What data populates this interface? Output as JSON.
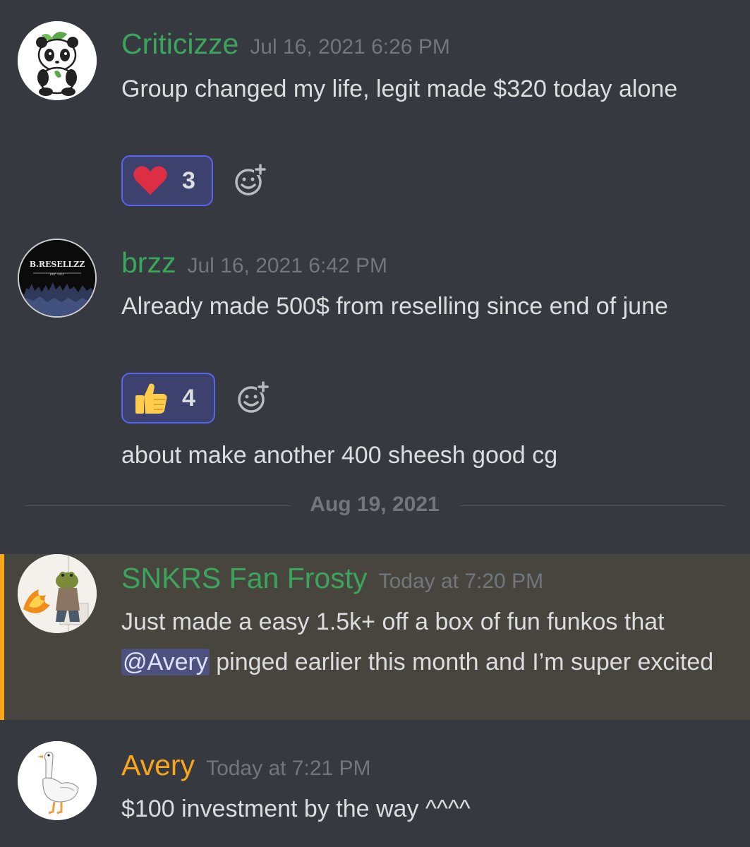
{
  "messages": [
    {
      "author": "Criticizze",
      "author_color": "#3ba55c",
      "timestamp": "Jul 16, 2021 6:26 PM",
      "text": "Group changed my life, legit made $320 today alone",
      "reaction": {
        "emoji": "heart-icon",
        "count": "3"
      }
    },
    {
      "author": "brzz",
      "author_color": "#3ba55c",
      "avatar_text": "B.RESELLZZ",
      "avatar_subtext": "EST. 2021",
      "timestamp": "Jul 16, 2021 6:42 PM",
      "text": "Already made 500$ from reselling since end of june",
      "reaction": {
        "emoji": "thumbs-up-icon",
        "count": "4"
      },
      "followup": "about make another 400 sheesh good cg"
    },
    {
      "author": "SNKRS Fan Frosty",
      "author_color": "#3ba55c",
      "timestamp": "Today at 7:20 PM",
      "text_before": "Just made a easy 1.5k+ off a box of fun funkos that ",
      "mention": "@Avery",
      "text_after": " pinged earlier this month and I’m super excited",
      "highlighted": true
    },
    {
      "author": "Avery",
      "author_color": "#faa61a",
      "timestamp": "Today at 7:21 PM",
      "text": "$100 investment by the way ^^^^"
    }
  ],
  "divider": {
    "label": "Aug 19, 2021"
  },
  "colors": {
    "background": "#36393f",
    "highlight": "#48453f",
    "highlight_bar": "#faa81a",
    "reaction_border": "#5865f2",
    "timestamp": "#72767d"
  }
}
